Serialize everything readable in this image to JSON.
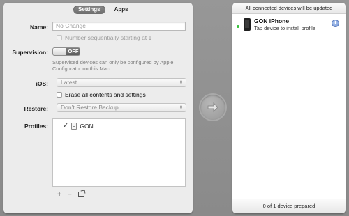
{
  "tabs": {
    "settings": "Settings",
    "apps": "Apps"
  },
  "form": {
    "name_label": "Name:",
    "name_placeholder": "No Change",
    "number_seq_label": "Number sequentially starting at 1",
    "supervision_label": "Supervision:",
    "supervision_toggle_text": "OFF",
    "supervision_state": "off",
    "supervision_note": "Supervised devices can only be configured by Apple Configurator on this Mac.",
    "ios_label": "iOS:",
    "ios_value": "Latest",
    "erase_label": "Erase all contents and settings",
    "restore_label": "Restore:",
    "restore_value": "Don’t Restore Backup",
    "profiles_label": "Profiles:",
    "profiles": [
      {
        "name": "GON",
        "checked": true
      }
    ]
  },
  "bottom_bar": {
    "add": "+",
    "remove": "−"
  },
  "right": {
    "header": "All connected devices will be updated",
    "device": {
      "name": "GON iPhone",
      "subtitle": "Tap device to install profile",
      "status_color": "#39c23c"
    },
    "footer": "0 of 1 device prepared"
  },
  "icons": {
    "go_arrow": "right-arrow-icon",
    "phone": "iphone-icon",
    "clock": "clock-icon",
    "share": "share-icon"
  },
  "colors": {
    "accent": "#39c23c",
    "background": "#8e8e8e"
  }
}
